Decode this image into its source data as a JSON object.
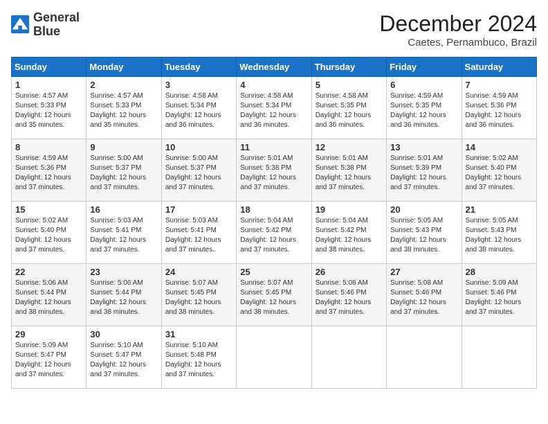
{
  "header": {
    "logo_line1": "General",
    "logo_line2": "Blue",
    "title": "December 2024",
    "location": "Caetes, Pernambuco, Brazil"
  },
  "weekdays": [
    "Sunday",
    "Monday",
    "Tuesday",
    "Wednesday",
    "Thursday",
    "Friday",
    "Saturday"
  ],
  "weeks": [
    [
      {
        "day": "1",
        "sunrise": "4:57 AM",
        "sunset": "5:33 PM",
        "daylight": "12 hours and 35 minutes."
      },
      {
        "day": "2",
        "sunrise": "4:57 AM",
        "sunset": "5:33 PM",
        "daylight": "12 hours and 35 minutes."
      },
      {
        "day": "3",
        "sunrise": "4:58 AM",
        "sunset": "5:34 PM",
        "daylight": "12 hours and 36 minutes."
      },
      {
        "day": "4",
        "sunrise": "4:58 AM",
        "sunset": "5:34 PM",
        "daylight": "12 hours and 36 minutes."
      },
      {
        "day": "5",
        "sunrise": "4:58 AM",
        "sunset": "5:35 PM",
        "daylight": "12 hours and 36 minutes."
      },
      {
        "day": "6",
        "sunrise": "4:59 AM",
        "sunset": "5:35 PM",
        "daylight": "12 hours and 36 minutes."
      },
      {
        "day": "7",
        "sunrise": "4:59 AM",
        "sunset": "5:36 PM",
        "daylight": "12 hours and 36 minutes."
      }
    ],
    [
      {
        "day": "8",
        "sunrise": "4:59 AM",
        "sunset": "5:36 PM",
        "daylight": "12 hours and 37 minutes."
      },
      {
        "day": "9",
        "sunrise": "5:00 AM",
        "sunset": "5:37 PM",
        "daylight": "12 hours and 37 minutes."
      },
      {
        "day": "10",
        "sunrise": "5:00 AM",
        "sunset": "5:37 PM",
        "daylight": "12 hours and 37 minutes."
      },
      {
        "day": "11",
        "sunrise": "5:01 AM",
        "sunset": "5:38 PM",
        "daylight": "12 hours and 37 minutes."
      },
      {
        "day": "12",
        "sunrise": "5:01 AM",
        "sunset": "5:38 PM",
        "daylight": "12 hours and 37 minutes."
      },
      {
        "day": "13",
        "sunrise": "5:01 AM",
        "sunset": "5:39 PM",
        "daylight": "12 hours and 37 minutes."
      },
      {
        "day": "14",
        "sunrise": "5:02 AM",
        "sunset": "5:40 PM",
        "daylight": "12 hours and 37 minutes."
      }
    ],
    [
      {
        "day": "15",
        "sunrise": "5:02 AM",
        "sunset": "5:40 PM",
        "daylight": "12 hours and 37 minutes."
      },
      {
        "day": "16",
        "sunrise": "5:03 AM",
        "sunset": "5:41 PM",
        "daylight": "12 hours and 37 minutes."
      },
      {
        "day": "17",
        "sunrise": "5:03 AM",
        "sunset": "5:41 PM",
        "daylight": "12 hours and 37 minutes."
      },
      {
        "day": "18",
        "sunrise": "5:04 AM",
        "sunset": "5:42 PM",
        "daylight": "12 hours and 37 minutes."
      },
      {
        "day": "19",
        "sunrise": "5:04 AM",
        "sunset": "5:42 PM",
        "daylight": "12 hours and 38 minutes."
      },
      {
        "day": "20",
        "sunrise": "5:05 AM",
        "sunset": "5:43 PM",
        "daylight": "12 hours and 38 minutes."
      },
      {
        "day": "21",
        "sunrise": "5:05 AM",
        "sunset": "5:43 PM",
        "daylight": "12 hours and 38 minutes."
      }
    ],
    [
      {
        "day": "22",
        "sunrise": "5:06 AM",
        "sunset": "5:44 PM",
        "daylight": "12 hours and 38 minutes."
      },
      {
        "day": "23",
        "sunrise": "5:06 AM",
        "sunset": "5:44 PM",
        "daylight": "12 hours and 38 minutes."
      },
      {
        "day": "24",
        "sunrise": "5:07 AM",
        "sunset": "5:45 PM",
        "daylight": "12 hours and 38 minutes."
      },
      {
        "day": "25",
        "sunrise": "5:07 AM",
        "sunset": "5:45 PM",
        "daylight": "12 hours and 38 minutes."
      },
      {
        "day": "26",
        "sunrise": "5:08 AM",
        "sunset": "5:46 PM",
        "daylight": "12 hours and 37 minutes."
      },
      {
        "day": "27",
        "sunrise": "5:08 AM",
        "sunset": "5:46 PM",
        "daylight": "12 hours and 37 minutes."
      },
      {
        "day": "28",
        "sunrise": "5:09 AM",
        "sunset": "5:46 PM",
        "daylight": "12 hours and 37 minutes."
      }
    ],
    [
      {
        "day": "29",
        "sunrise": "5:09 AM",
        "sunset": "5:47 PM",
        "daylight": "12 hours and 37 minutes."
      },
      {
        "day": "30",
        "sunrise": "5:10 AM",
        "sunset": "5:47 PM",
        "daylight": "12 hours and 37 minutes."
      },
      {
        "day": "31",
        "sunrise": "5:10 AM",
        "sunset": "5:48 PM",
        "daylight": "12 hours and 37 minutes."
      },
      null,
      null,
      null,
      null
    ]
  ]
}
